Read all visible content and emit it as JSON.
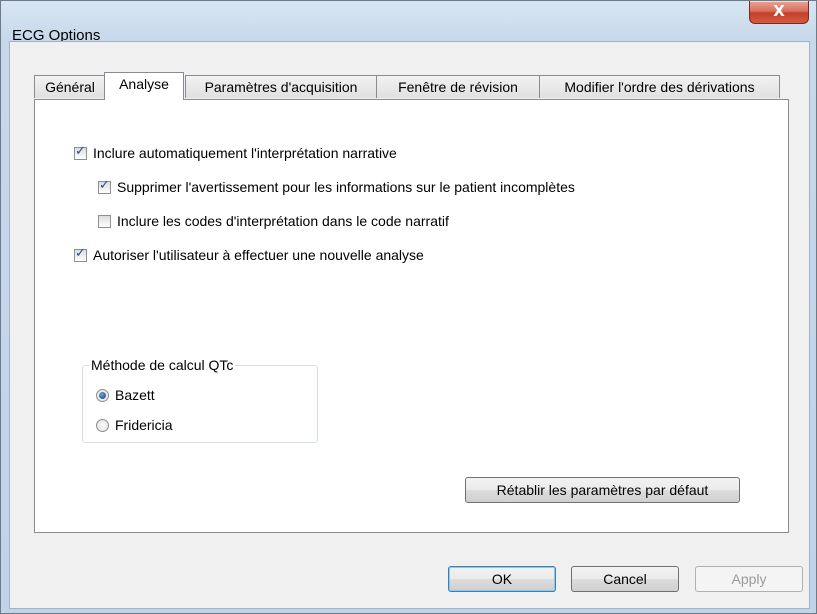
{
  "window": {
    "title": "ECG Options",
    "close_label": "X"
  },
  "tabs": [
    {
      "label": "Général"
    },
    {
      "label": "Analyse"
    },
    {
      "label": "Paramètres d'acquisition"
    },
    {
      "label": "Fenêtre de révision"
    },
    {
      "label": "Modifier l'ordre des dérivations"
    }
  ],
  "options": {
    "auto_narrative": {
      "label": "Inclure automatiquement l'interprétation narrative",
      "checked": true
    },
    "suppress_warning": {
      "label": "Supprimer l'avertissement pour les informations sur le patient incomplètes",
      "checked": true
    },
    "include_codes": {
      "label": "Inclure les codes d'interprétation dans le code narratif",
      "checked": false
    },
    "allow_reanalysis": {
      "label": "Autoriser l'utilisateur à effectuer une nouvelle analyse",
      "checked": true
    }
  },
  "qtc": {
    "legend": "Méthode de calcul QTc",
    "options": [
      {
        "label": "Bazett",
        "selected": true
      },
      {
        "label": "Fridericia",
        "selected": false
      }
    ]
  },
  "buttons": {
    "reset": "Rétablir les paramètres par défaut",
    "ok": "OK",
    "cancel": "Cancel",
    "apply": "Apply"
  }
}
